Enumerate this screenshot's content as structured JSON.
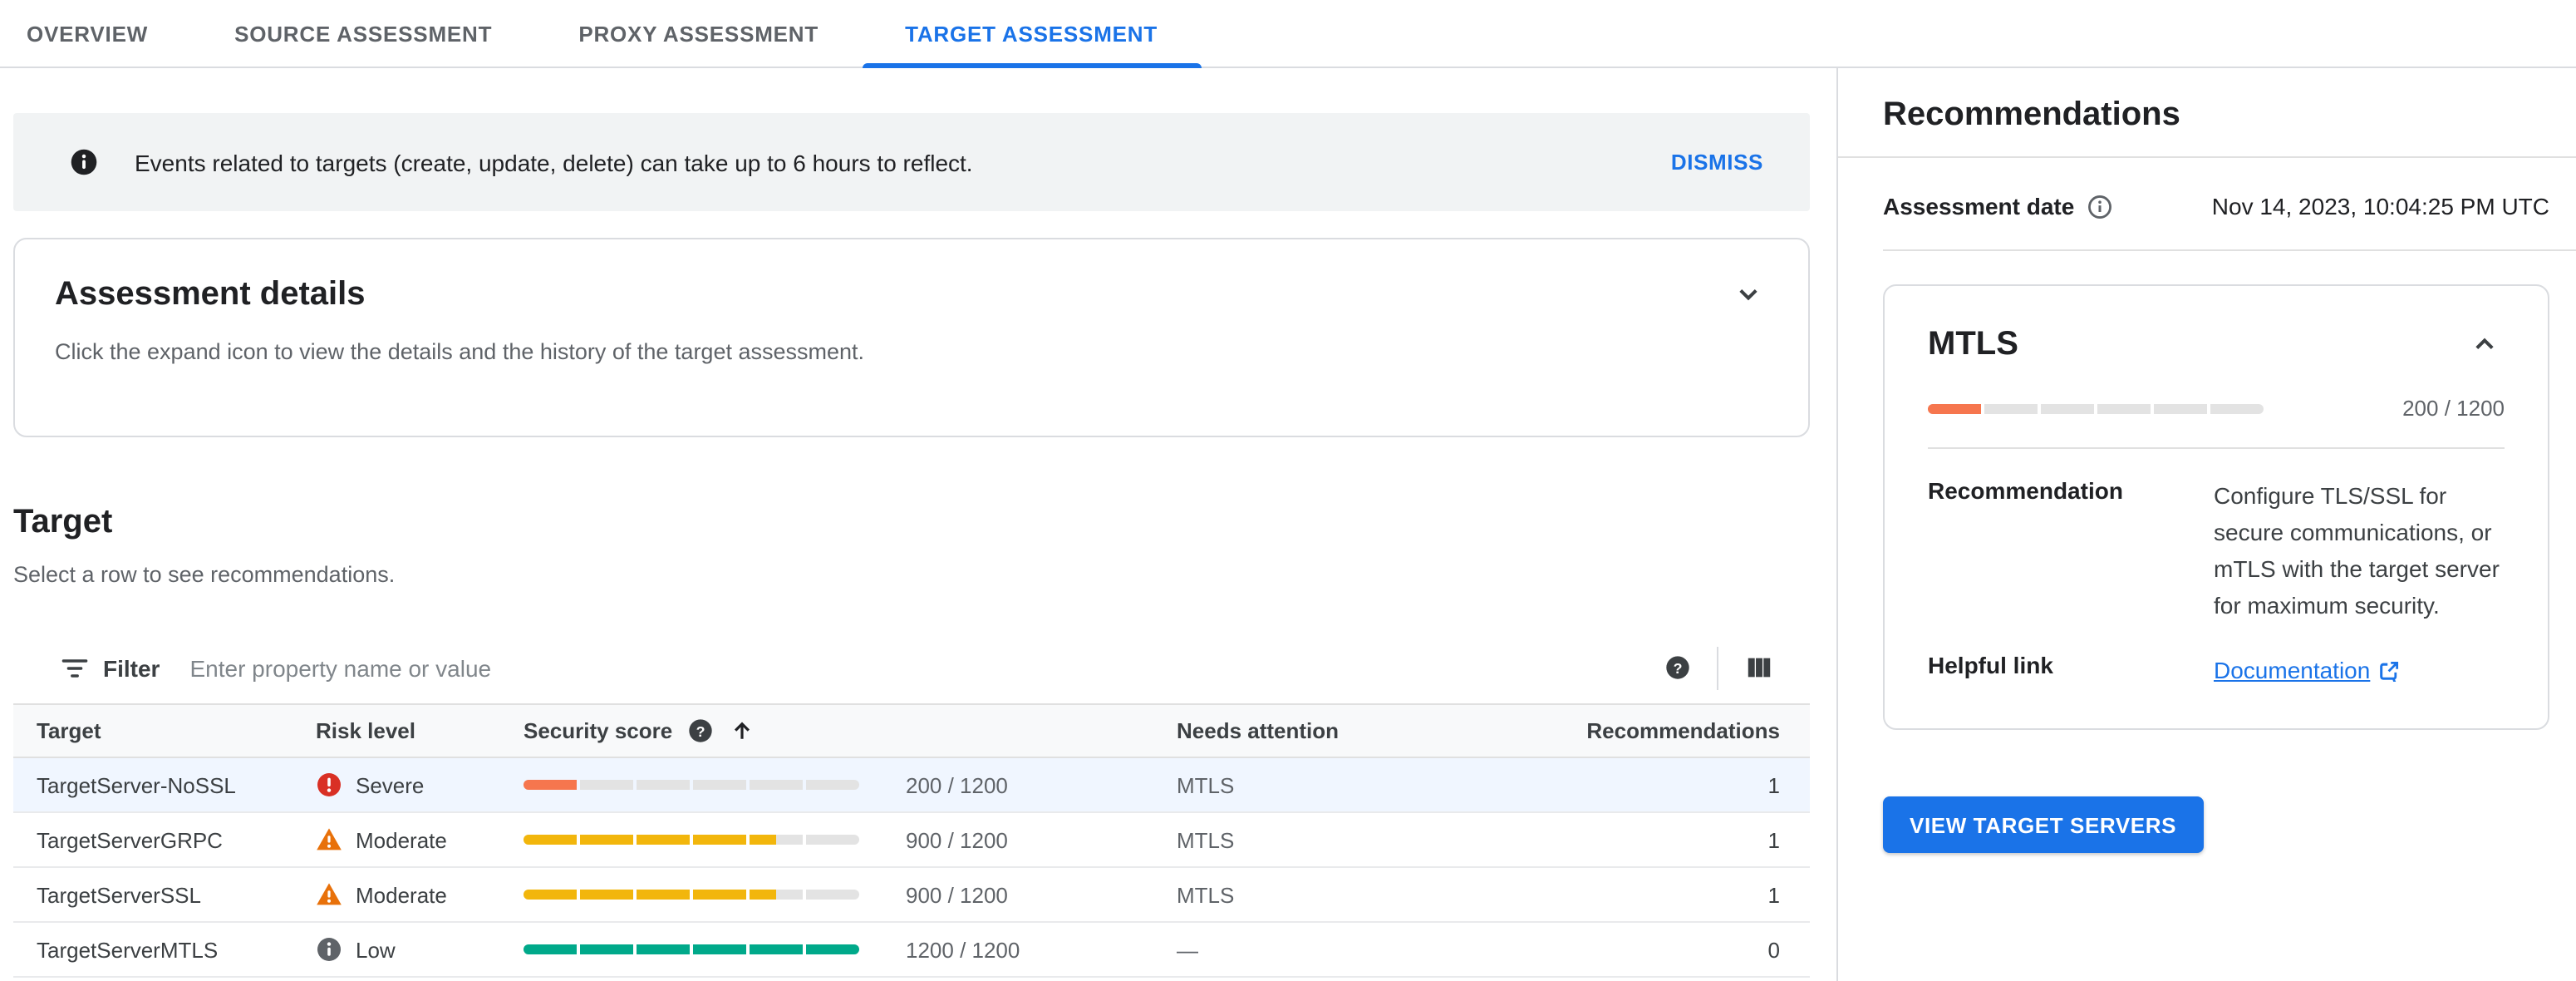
{
  "tabs": [
    {
      "label": "OVERVIEW",
      "active": false
    },
    {
      "label": "SOURCE ASSESSMENT",
      "active": false
    },
    {
      "label": "PROXY ASSESSMENT",
      "active": false
    },
    {
      "label": "TARGET ASSESSMENT",
      "active": true
    }
  ],
  "banner": {
    "text": "Events related to targets (create, update, delete) can take up to 6 hours to reflect.",
    "dismiss_label": "DISMISS"
  },
  "assessment_details": {
    "title": "Assessment details",
    "description": "Click the expand icon to view the details and the history of the target assessment."
  },
  "target_section": {
    "title": "Target",
    "subtitle": "Select a row to see recommendations."
  },
  "toolbar": {
    "filter_label": "Filter",
    "filter_placeholder": "Enter property name or value"
  },
  "table": {
    "columns": {
      "target": "Target",
      "risk": "Risk level",
      "score": "Security score",
      "attention": "Needs attention",
      "recommendations": "Recommendations"
    },
    "rows": [
      {
        "target": "TargetServer-NoSSL",
        "risk": "Severe",
        "score": 200,
        "max": 1200,
        "score_label": "200 / 1200",
        "needs_attention": "MTLS",
        "recommendations": "1",
        "selected": true
      },
      {
        "target": "TargetServerGRPC",
        "risk": "Moderate",
        "score": 900,
        "max": 1200,
        "score_label": "900 / 1200",
        "needs_attention": "MTLS",
        "recommendations": "1",
        "selected": false
      },
      {
        "target": "TargetServerSSL",
        "risk": "Moderate",
        "score": 900,
        "max": 1200,
        "score_label": "900 / 1200",
        "needs_attention": "MTLS",
        "recommendations": "1",
        "selected": false
      },
      {
        "target": "TargetServerMTLS",
        "risk": "Low",
        "score": 1200,
        "max": 1200,
        "score_label": "1200 / 1200",
        "needs_attention": "—",
        "recommendations": "0",
        "selected": false
      }
    ]
  },
  "panel": {
    "title": "Recommendations",
    "date_label": "Assessment date",
    "date_value": "Nov 14, 2023, 10:04:25 PM UTC",
    "card": {
      "title": "MTLS",
      "score": 200,
      "max": 1200,
      "score_label": "200 / 1200",
      "recommendation_label": "Recommendation",
      "recommendation_text": "Configure TLS/SSL for secure communications, or mTLS with the target server for maximum security.",
      "link_label": "Helpful link",
      "link_text": "Documentation"
    },
    "view_button": "VIEW TARGET SERVERS"
  },
  "colors": {
    "accent": "#1a73e8",
    "severe_icon": "#d93025",
    "moderate_icon": "#e8710a",
    "low_icon": "#5f6368",
    "bar_severe": "#f6764e",
    "bar_moderate": "#f2b60c",
    "bar_low": "#00a98a",
    "bar_empty": "#e3e3e3"
  }
}
